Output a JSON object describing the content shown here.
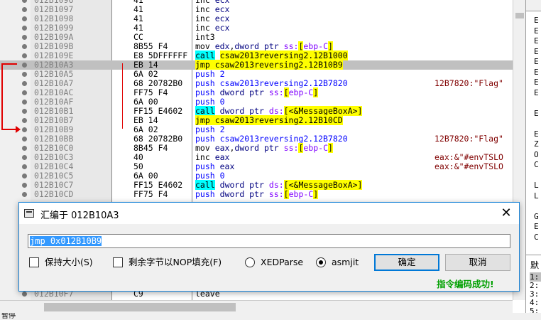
{
  "disasm": {
    "rows": [
      {
        "addr": "012B1096",
        "bytes": "41",
        "ins": [
          [
            "t-mnem",
            "inc "
          ],
          [
            "t-kw",
            "ecx"
          ]
        ],
        "cmt": ""
      },
      {
        "addr": "012B1097",
        "bytes": "41",
        "ins": [
          [
            "t-mnem",
            "inc "
          ],
          [
            "t-kw",
            "ecx"
          ]
        ],
        "cmt": ""
      },
      {
        "addr": "012B1098",
        "bytes": "41",
        "ins": [
          [
            "t-mnem",
            "inc "
          ],
          [
            "t-kw",
            "ecx"
          ]
        ],
        "cmt": ""
      },
      {
        "addr": "012B1099",
        "bytes": "41",
        "ins": [
          [
            "t-mnem",
            "inc "
          ],
          [
            "t-kw",
            "ecx"
          ]
        ],
        "cmt": ""
      },
      {
        "addr": "012B109A",
        "bytes": "CC",
        "ins": [
          [
            "t-mnem",
            "int3"
          ]
        ],
        "cmt": ""
      },
      {
        "addr": "012B109B",
        "bytes": "8B55 F4",
        "ins": [
          [
            "t-mnem",
            "mov "
          ],
          [
            "t-kw",
            "edx"
          ],
          [
            "t-mnem",
            ","
          ],
          [
            "t-kw",
            "dword ptr "
          ],
          [
            "t-seg",
            "ss:"
          ],
          [
            "t-brk",
            "["
          ],
          [
            "t-seg",
            "ebp-C"
          ],
          [
            "t-brk",
            "]"
          ]
        ],
        "cmt": ""
      },
      {
        "addr": "012B109E",
        "bytes": "E8 5DFFFFFF",
        "ins": [
          [
            "m-call",
            "call"
          ],
          [
            "t-mnem",
            " "
          ],
          [
            "m-jmp",
            "csaw2013reversing2.12B1000"
          ]
        ],
        "cmt": ""
      },
      {
        "addr": "012B10A3",
        "bytes": "EB 14",
        "ins": [
          [
            "m-jmp",
            "jmp csaw2013reversing2.12B10B9"
          ]
        ],
        "cmt": "",
        "cur": true
      },
      {
        "addr": "012B10A5",
        "bytes": "6A 02",
        "ins": [
          [
            "t-push",
            "push 2"
          ]
        ],
        "cmt": ""
      },
      {
        "addr": "012B10A7",
        "bytes": "68 20782B0",
        "ins": [
          [
            "t-push",
            "push csaw2013reversing2.12B7820"
          ]
        ],
        "cmt": "12B7820:\"Flag\""
      },
      {
        "addr": "012B10AC",
        "bytes": "FF75 F4",
        "ins": [
          [
            "t-push",
            "push "
          ],
          [
            "t-kw",
            "dword ptr "
          ],
          [
            "t-seg",
            "ss:"
          ],
          [
            "t-brk",
            "["
          ],
          [
            "t-seg",
            "ebp-C"
          ],
          [
            "t-brk",
            "]"
          ]
        ],
        "cmt": ""
      },
      {
        "addr": "012B10AF",
        "bytes": "6A 00",
        "ins": [
          [
            "t-push",
            "push 0"
          ]
        ],
        "cmt": ""
      },
      {
        "addr": "012B10B1",
        "bytes": "FF15 E4602",
        "ins": [
          [
            "m-call",
            "call"
          ],
          [
            "t-mnem",
            " "
          ],
          [
            "t-kw",
            "dword ptr "
          ],
          [
            "t-seg",
            "ds:"
          ],
          [
            "t-brk",
            "["
          ],
          [
            "m-jmp",
            "<&MessageBoxA>"
          ],
          [
            "t-brk",
            "]"
          ]
        ],
        "cmt": ""
      },
      {
        "addr": "012B10B7",
        "bytes": "EB 14",
        "ins": [
          [
            "m-jmp",
            "jmp csaw2013reversing2.12B10CD"
          ]
        ],
        "cmt": ""
      },
      {
        "addr": "012B10B9",
        "bytes": "6A 02",
        "ins": [
          [
            "t-push",
            "push 2"
          ]
        ],
        "cmt": ""
      },
      {
        "addr": "012B10BB",
        "bytes": "68 20782B0",
        "ins": [
          [
            "t-push",
            "push csaw2013reversing2.12B7820"
          ]
        ],
        "cmt": "12B7820:\"Flag\""
      },
      {
        "addr": "012B10C0",
        "bytes": "8B45 F4",
        "ins": [
          [
            "t-mnem",
            "mov "
          ],
          [
            "t-kw",
            "eax"
          ],
          [
            "t-mnem",
            ","
          ],
          [
            "t-kw",
            "dword ptr "
          ],
          [
            "t-seg",
            "ss:"
          ],
          [
            "t-brk",
            "["
          ],
          [
            "t-seg",
            "ebp-C"
          ],
          [
            "t-brk",
            "]"
          ]
        ],
        "cmt": ""
      },
      {
        "addr": "012B10C3",
        "bytes": "40",
        "ins": [
          [
            "t-mnem",
            "inc "
          ],
          [
            "t-kw",
            "eax"
          ]
        ],
        "cmt": "eax:&\"#envTSLO"
      },
      {
        "addr": "012B10C4",
        "bytes": "50",
        "ins": [
          [
            "t-push",
            "push "
          ],
          [
            "t-kw",
            "eax"
          ]
        ],
        "cmt": "eax:&\"#envTSLO"
      },
      {
        "addr": "012B10C5",
        "bytes": "6A 00",
        "ins": [
          [
            "t-push",
            "push 0"
          ]
        ],
        "cmt": ""
      },
      {
        "addr": "012B10C7",
        "bytes": "FF15 E4602",
        "ins": [
          [
            "m-call",
            "call"
          ],
          [
            "t-mnem",
            " "
          ],
          [
            "t-kw",
            "dword ptr "
          ],
          [
            "t-seg",
            "ds:"
          ],
          [
            "t-brk",
            "["
          ],
          [
            "m-jmp",
            "<&MessageBoxA>"
          ],
          [
            "t-brk",
            "]"
          ]
        ],
        "cmt": ""
      },
      {
        "addr": "012B10CD",
        "bytes": "FF75 F4",
        "ins": [
          [
            "t-push",
            "push "
          ],
          [
            "t-kw",
            "dword ptr "
          ],
          [
            "t-seg",
            "ss:"
          ],
          [
            "t-brk",
            "["
          ],
          [
            "t-seg",
            "ebp-C"
          ],
          [
            "t-brk",
            "]"
          ]
        ],
        "cmt": ""
      },
      {
        "addr": "012B10F7",
        "bytes": "C9",
        "ins": [
          [
            "t-mnem",
            "leave"
          ]
        ],
        "cmt": ""
      }
    ]
  },
  "right_panel": {
    "letters": [
      "E",
      "E",
      "E",
      "E",
      "E",
      "E",
      "E",
      "E",
      "",
      "E",
      "",
      "E",
      "Z",
      "O",
      "C",
      "",
      "L",
      "L",
      "",
      "G",
      "E",
      "C"
    ],
    "bottom_items": [
      "1:",
      "2:",
      "3:",
      "4:",
      "5:"
    ],
    "bottom_header": "默"
  },
  "statusbar": {
    "text": "暂停"
  },
  "dialog": {
    "title": "汇编于 012B10A3",
    "close_glyph": "✕",
    "input_value": "jmp 0x012B10B9",
    "opt_keep_size": "保持大小(S)",
    "opt_fill_nop": "剩余字节以NOP填充(F)",
    "opt_xedparse": "XEDParse",
    "opt_asmjit": "asmjit",
    "ok_label": "确定",
    "cancel_label": "取消",
    "status": "指令编码成功!"
  }
}
